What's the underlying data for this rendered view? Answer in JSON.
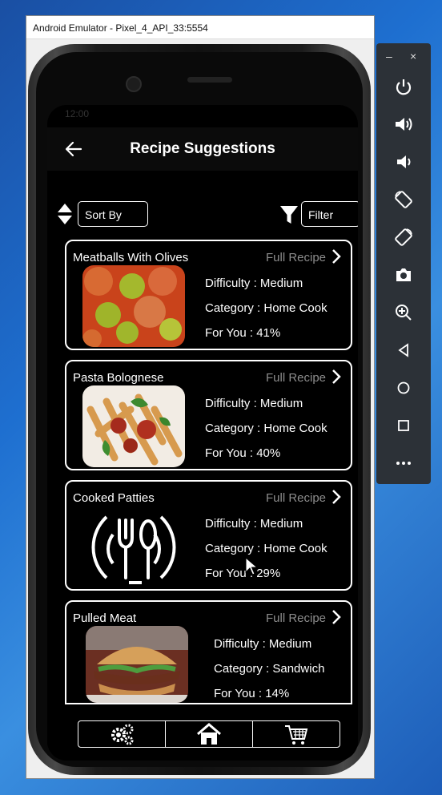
{
  "window": {
    "title": "Android Emulator - Pixel_4_API_33:5554"
  },
  "status_bar": {
    "time": "12:00"
  },
  "app_bar": {
    "title": "Recipe Suggestions"
  },
  "controls": {
    "sort_label": "Sort By",
    "filter_label": "Filter"
  },
  "recipes": [
    {
      "name": "Meatballs With Olives",
      "link": "Full Recipe",
      "difficulty": "Difficulty : Medium",
      "category": "Category : Home Cook",
      "for_you": "For You : 41%"
    },
    {
      "name": "Pasta Bolognese",
      "link": "Full Recipe",
      "difficulty": "Difficulty : Medium",
      "category": "Category : Home Cook",
      "for_you": "For You : 40%"
    },
    {
      "name": "Cooked Patties",
      "link": "Full Recipe",
      "difficulty": "Difficulty : Medium",
      "category": "Category : Home Cook",
      "for_you": "For You : 29%"
    },
    {
      "name": "Pulled Meat",
      "link": "Full Recipe",
      "difficulty": "Difficulty : Medium",
      "category": "Category : Sandwich",
      "for_you": "For You : 14%"
    }
  ],
  "bottom_nav": {
    "items": [
      "settings-icon",
      "home-icon",
      "cart-icon"
    ]
  },
  "emulator_toolbar": {
    "minimize": "–",
    "close": "×",
    "buttons": [
      "power-icon",
      "volume-up-icon",
      "volume-down-icon",
      "rotate-left-icon",
      "rotate-right-icon",
      "camera-icon",
      "zoom-icon",
      "back-icon",
      "home-icon",
      "overview-icon",
      "more-icon"
    ]
  }
}
